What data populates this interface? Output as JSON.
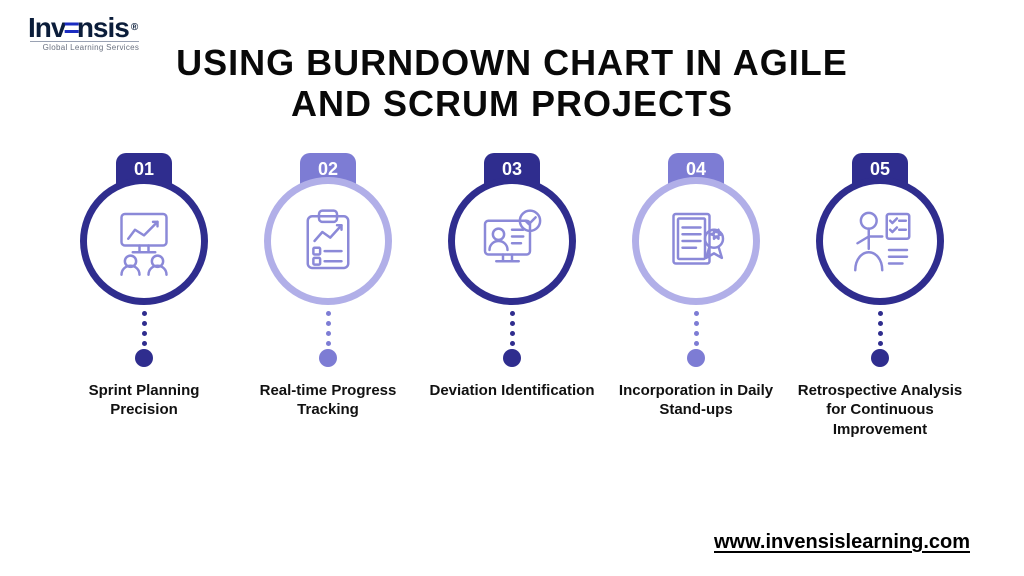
{
  "brand": {
    "name_left": "Inv",
    "name_accent": "=",
    "name_right": "nsis",
    "registered": "®",
    "tagline": "Global Learning Services"
  },
  "title_line1": "USING BURNDOWN CHART IN AGILE",
  "title_line2": "AND SCRUM PROJECTS",
  "items": [
    {
      "num": "01",
      "label": "Sprint Planning Precision",
      "variant": "dark",
      "icon": "presentation-team-icon"
    },
    {
      "num": "02",
      "label": "Real-time Progress Tracking",
      "variant": "light",
      "icon": "clipboard-chart-icon"
    },
    {
      "num": "03",
      "label": "Deviation Identification",
      "variant": "dark",
      "icon": "monitor-profile-check-icon"
    },
    {
      "num": "04",
      "label": "Incorporation in Daily Stand-ups",
      "variant": "light",
      "icon": "document-badge-icon"
    },
    {
      "num": "05",
      "label": "Retrospective Analysis for Continuous Improvement",
      "variant": "dark",
      "icon": "person-checklist-icon"
    }
  ],
  "website": "www.invensislearning.com",
  "colors": {
    "dark": "#2f2d8e",
    "light": "#7d7cd4",
    "circle_light_border": "#b1afe8",
    "icon_stroke": "#8b89d8"
  }
}
